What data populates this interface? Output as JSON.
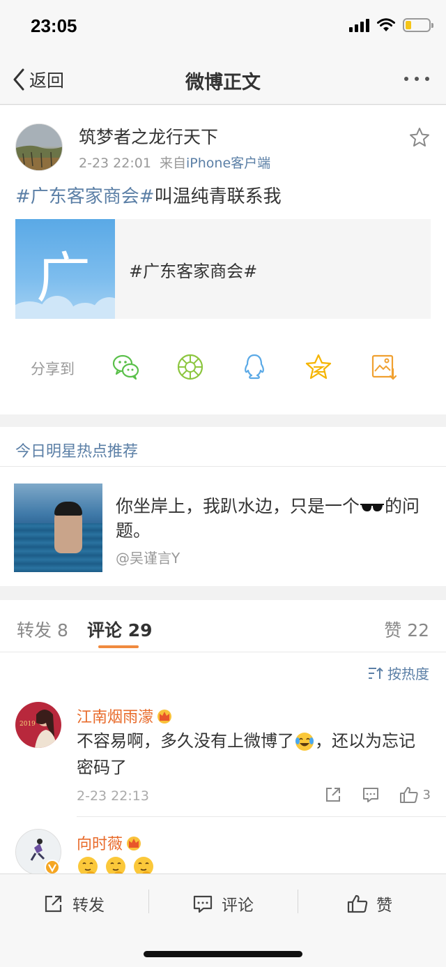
{
  "status_bar": {
    "time": "23:05",
    "icons": [
      "signal-icon",
      "wifi-icon",
      "battery-icon"
    ],
    "battery_level": 0.25
  },
  "nav": {
    "back_label": "返回",
    "title": "微博正文",
    "more_icon": "more-icon"
  },
  "post": {
    "author": "筑梦者之龙行天下",
    "time": "2-23 22:01",
    "source_prefix": "来自",
    "source": "iPhone客户端",
    "topic_tag": "#广东客家商会#",
    "text": "叫温纯青联系我",
    "topic_card": {
      "thumb_char": "广",
      "label": "#广东客家商会#"
    },
    "share": {
      "label": "分享到",
      "targets": [
        "wechat-icon",
        "moments-icon",
        "qq-icon",
        "qzone-icon",
        "save-image-icon"
      ]
    }
  },
  "recommend": {
    "title": "今日明星热点推荐",
    "text_before": "你坐岸上，我趴水边，只是一个",
    "text_after": "的问题。",
    "author": "@吴谨言Y"
  },
  "tabs": {
    "repost_label": "转发",
    "repost_count": "8",
    "comment_label": "评论",
    "comment_count": "29",
    "like_label": "赞",
    "like_count": "22"
  },
  "sort_label": "按热度",
  "comments": [
    {
      "name": "江南烟雨濛",
      "text_before": "不容易啊，多久没有上微博了",
      "text_after": "，还以为忘记密码了",
      "time": "2-23 22:13",
      "like_count": "3"
    },
    {
      "name": "向时薇",
      "emoji_count": 3
    }
  ],
  "colors": {
    "link_blue": "#5b7fa6",
    "orange_name": "#e86b2b",
    "tab_underline": "#f08a3e",
    "wechat_green": "#5ac04a",
    "moments_green": "#8cc63f",
    "qq_blue": "#5aa9e6",
    "qzone_yellow": "#f5b400",
    "save_orange": "#f0a030"
  },
  "bottom_bar": {
    "repost_label": "转发",
    "comment_label": "评论",
    "like_label": "赞"
  }
}
